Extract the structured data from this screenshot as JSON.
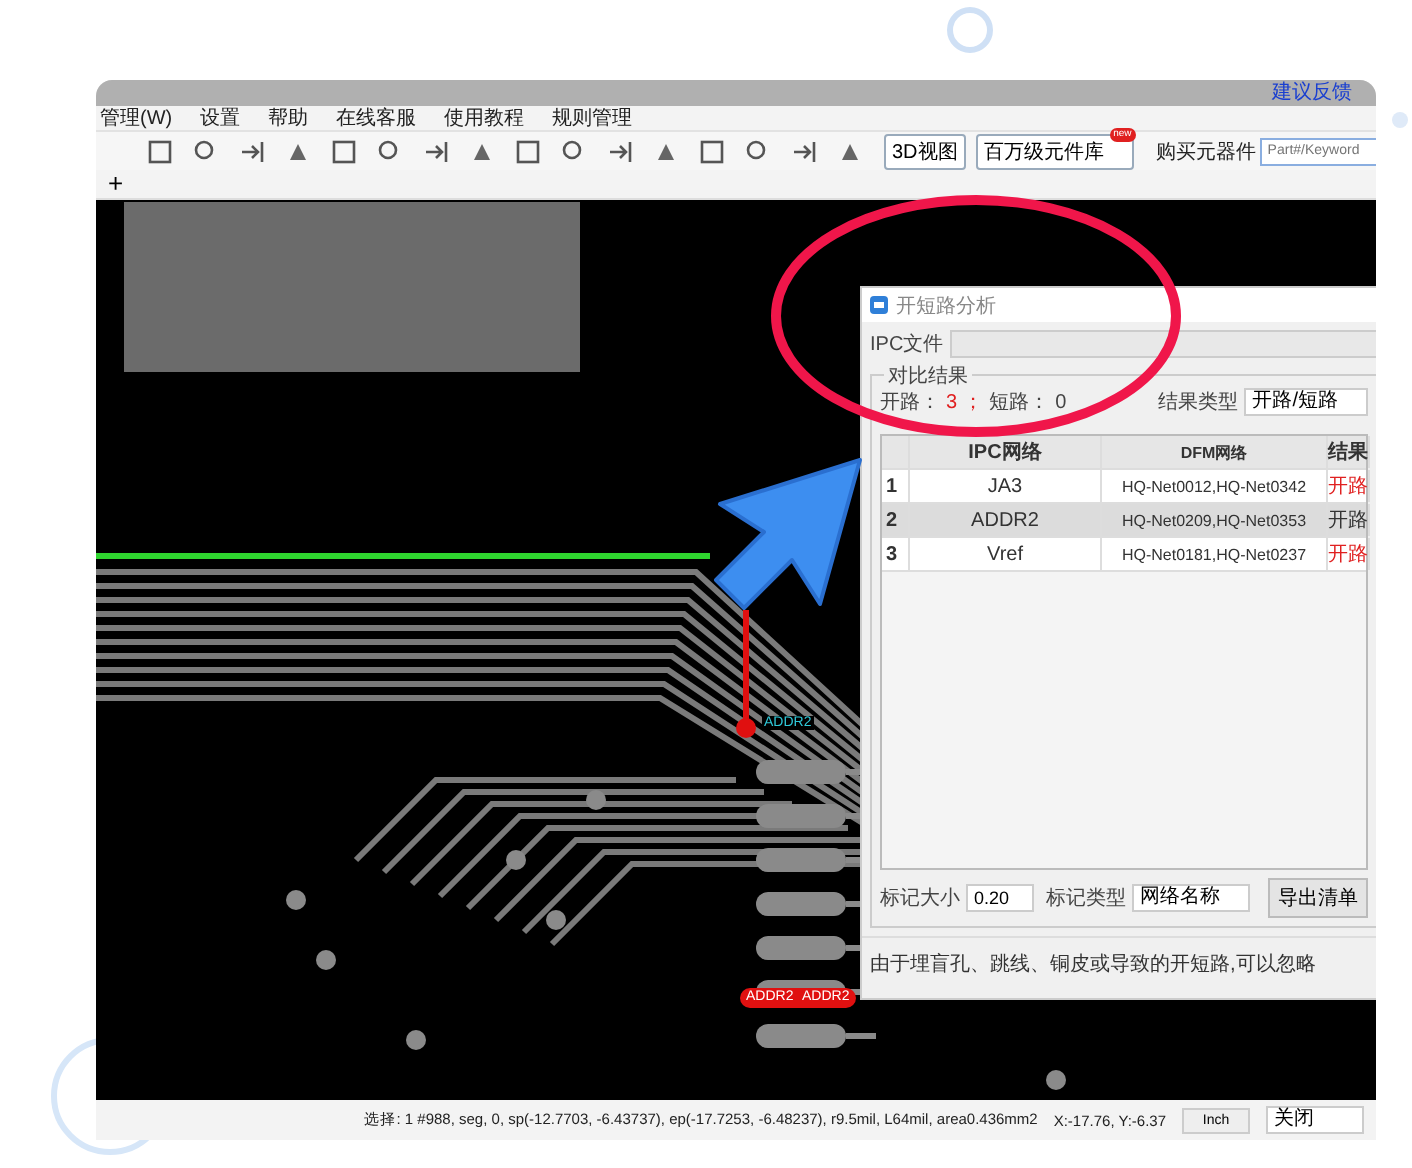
{
  "window": {
    "feedback_link": "建议反馈"
  },
  "menu": [
    "管理(W)",
    "设置",
    "帮助",
    "在线客服",
    "使用教程",
    "规则管理"
  ],
  "toolbar": {
    "view_3d_button": "3D视图",
    "library_button": {
      "label": "百万级元件库",
      "badge": "new"
    },
    "purchase_label": "购买元器件",
    "search": {
      "placeholder": "Part#/Keyword"
    }
  },
  "tab_add": "+",
  "pcb_labels": [
    {
      "text": "ADDR2"
    },
    {
      "text": "ADDR2"
    },
    {
      "text": "ADDR2"
    }
  ],
  "dialog": {
    "title": "开短路分析",
    "ipc_file_label": "IPC文件",
    "group_title": "对比结果",
    "open_label": "开路：",
    "open_count": "3",
    "separator": "；",
    "short_label": "短路：",
    "short_count": "0",
    "result_type_label": "结果类型",
    "result_type_value": "开路/短路",
    "columns": [
      "IPC网络",
      "DFM网络",
      "结果"
    ],
    "rows": [
      {
        "index": "1",
        "ipc_net": "JA3",
        "dfm_net": "HQ-Net0012,HQ-Net0342",
        "result": "开路",
        "selected": false
      },
      {
        "index": "2",
        "ipc_net": "ADDR2",
        "dfm_net": "HQ-Net0209,HQ-Net0353",
        "result": "开路",
        "selected": true
      },
      {
        "index": "3",
        "ipc_net": "Vref",
        "dfm_net": "HQ-Net0181,HQ-Net0237",
        "result": "开路",
        "selected": false
      }
    ],
    "mark_size_label": "标记大小",
    "mark_size_value": "0.20",
    "mark_type_label": "标记类型",
    "mark_type_value": "网络名称",
    "export_button": "导出清单",
    "note": "由于埋盲孔、跳线、铜皮或导致的开短路,可以忽略"
  },
  "status_bar": {
    "selection": "选择: 1 #988, seg, 0, sp(-12.7703, -6.43737), ep(-17.7253, -6.48237), r9.5mil, L64mil, area0.436mm2",
    "coords": "X:-17.76, Y:-6.37",
    "unit_button": "Inch",
    "mode_select": "关闭"
  }
}
